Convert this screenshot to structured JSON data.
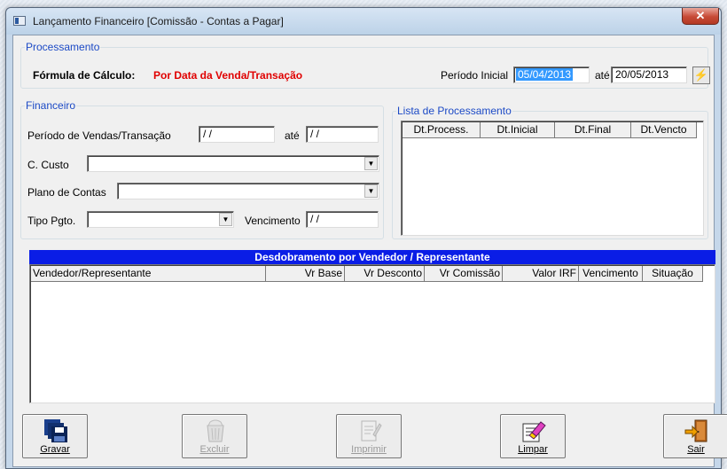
{
  "window": {
    "title": "Lançamento Financeiro [Comissão - Contas a Pagar]",
    "close_icon": "close-icon"
  },
  "processamento": {
    "legend": "Processamento",
    "formula_label": "Fórmula de Cálculo:",
    "formula_value": "Por Data da Venda/Transação",
    "periodo_label": "Período Inicial",
    "periodo_inicial": "05/04/2013",
    "ate_label": "até",
    "periodo_final": "20/05/2013"
  },
  "financeiro": {
    "legend": "Financeiro",
    "periodo_label": "Período de Vendas/Transação",
    "periodo_de": "/ /",
    "ate_label": "até",
    "periodo_ate": "/ /",
    "custo_label": "C. Custo",
    "custo_value": "",
    "plano_label": "Plano de Contas",
    "plano_value": "",
    "tipo_label": "Tipo Pgto.",
    "tipo_value": "",
    "vencimento_label": "Vencimento",
    "vencimento_value": "/ /"
  },
  "lista": {
    "legend": "Lista de Processamento",
    "columns": [
      "Dt.Process.",
      "Dt.Inicial",
      "Dt.Final",
      "Dt.Vencto"
    ]
  },
  "desdobramento": {
    "header": "Desdobramento por Vendedor / Representante",
    "columns": [
      "Vendedor/Representante",
      "Vr Base",
      "Vr Desconto",
      "Vr Comissão",
      "Valor IRF",
      "Vencimento",
      "Situação"
    ]
  },
  "toolbar": {
    "gravar": "Gravar",
    "excluir": "Excluir",
    "imprimir": "Imprimir",
    "limpar": "Limpar",
    "sair": "Sair"
  },
  "colors": {
    "accent": "#0a1de6",
    "formula": "#e00000",
    "legend": "#1c4ac6"
  }
}
